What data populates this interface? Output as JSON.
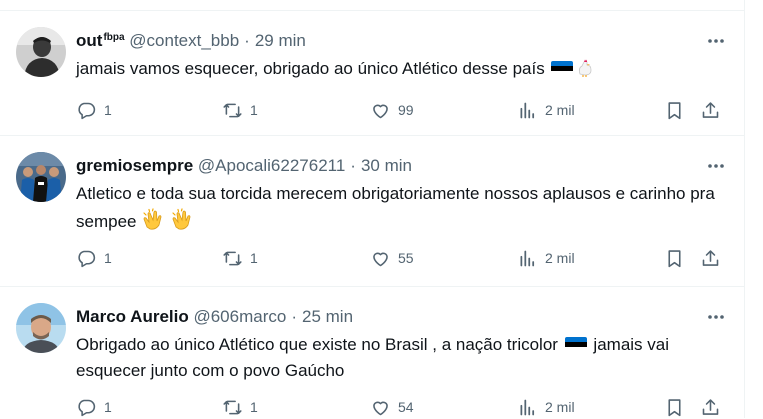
{
  "tweets": [
    {
      "name": "out",
      "name_sup": "fbpa",
      "handle": "@context_bbb",
      "time": "29 min",
      "text": "jamais vamos esquecer, obrigado ao único Atlético desse país",
      "emoji_tail": [
        "estonia-flag",
        "rooster"
      ],
      "replies": "1",
      "retweets": "1",
      "likes": "99",
      "views": "2 mil"
    },
    {
      "name": "gremiosempre",
      "handle": "@Apocali62276211",
      "time": "30 min",
      "text": "Atletico e toda sua torcida merecem obrigatoriamente nossos aplausos e carinho pra sempee",
      "emoji_tail": [
        "clapping-hands",
        "clapping-hands"
      ],
      "replies": "1",
      "retweets": "1",
      "likes": "55",
      "views": "2 mil"
    },
    {
      "name": "Marco Aurelio",
      "handle": "@606marco",
      "time": "25 min",
      "text_before": "Obrigado ao único Atlético que existe no Brasil , a nação tricolor",
      "text_after": "jamais vai esquecer junto com o povo Gaúcho",
      "emoji_inline": [
        "estonia-flag"
      ],
      "replies": "1",
      "retweets": "1",
      "likes": "54",
      "views": "2 mil"
    }
  ],
  "icons": {
    "reply": "reply-icon",
    "retweet": "retweet-icon",
    "like": "heart-icon",
    "views": "views-icon",
    "bookmark": "bookmark-icon",
    "share": "share-icon",
    "more": "more-icon"
  },
  "colors": {
    "text": "#0f1419",
    "secondary": "#536471",
    "divider": "#eff3f4",
    "flag_blue": "#0072ce"
  }
}
